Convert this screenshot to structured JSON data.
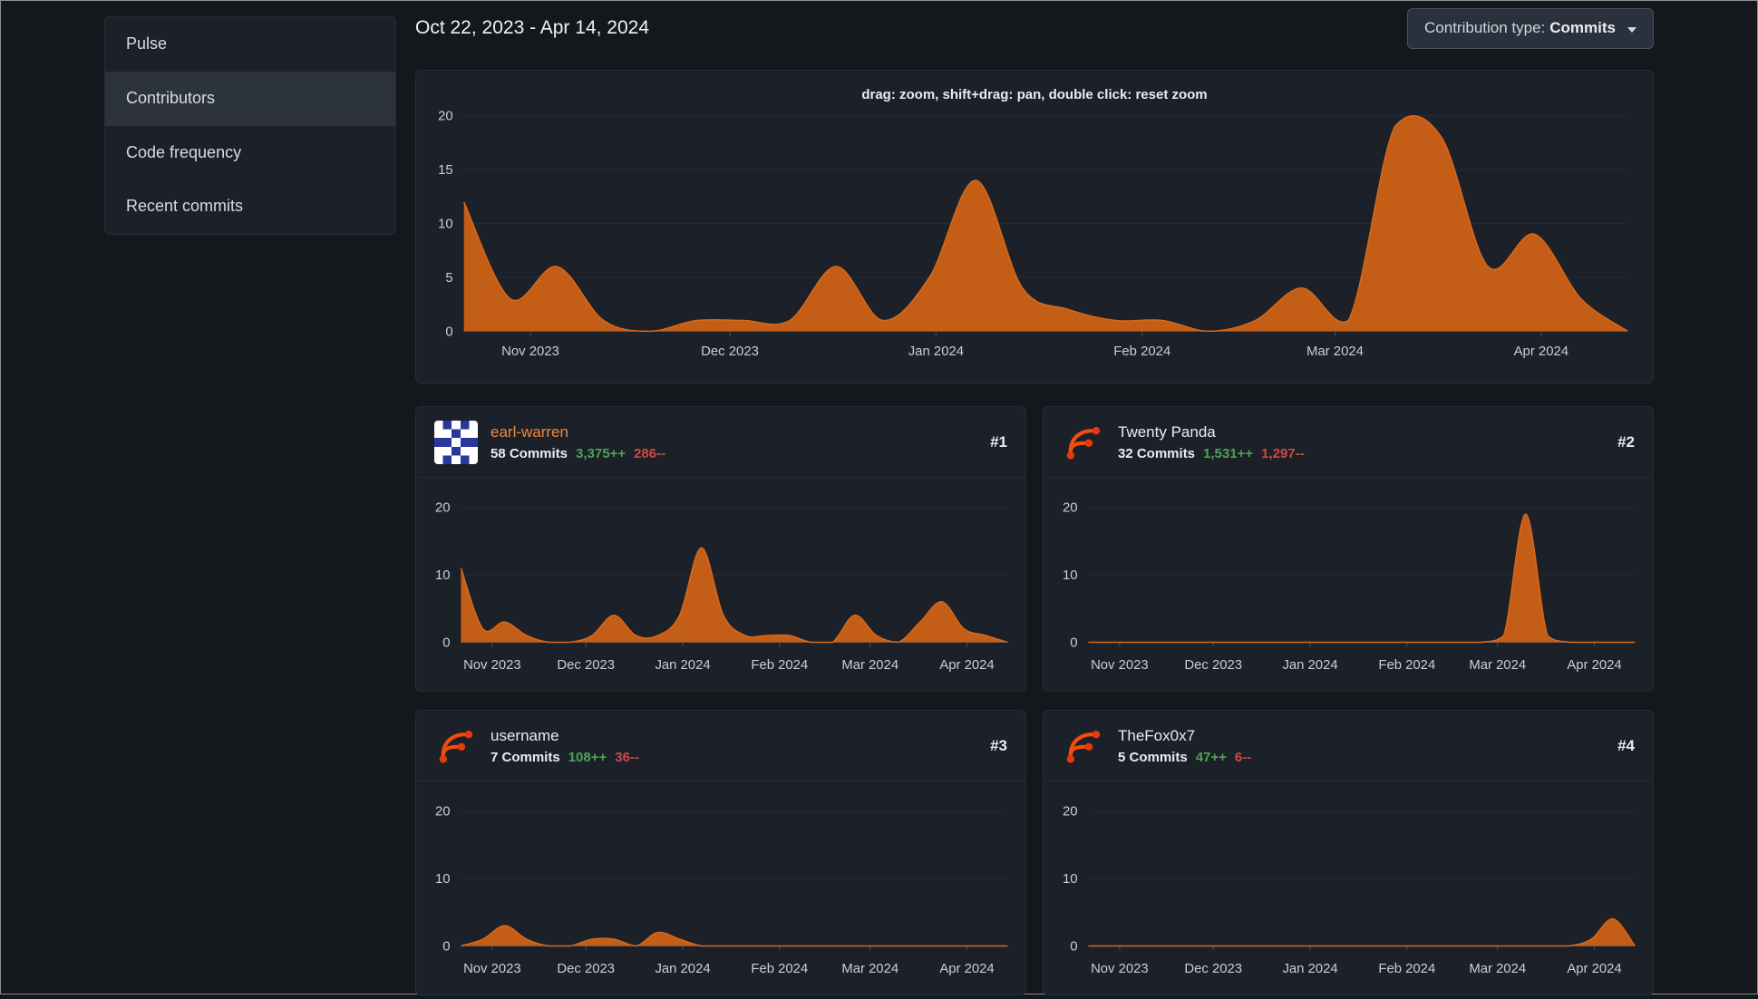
{
  "header": {
    "date_range": "Oct 22, 2023 - Apr 14, 2024",
    "contribution_type_label": "Contribution type:",
    "contribution_type_value": "Commits"
  },
  "sidebar": {
    "items": [
      {
        "label": "Pulse"
      },
      {
        "label": "Contributors"
      },
      {
        "label": "Code frequency"
      },
      {
        "label": "Recent commits"
      }
    ],
    "active": "Contributors"
  },
  "main_chart": {
    "hint": "drag: zoom, shift+drag: pan, double click: reset zoom"
  },
  "contributors": [
    {
      "rank": "#1",
      "name": "earl-warren",
      "commits": "58 Commits",
      "additions": "3,375++",
      "deletions": "286--",
      "avatar": "identicon-blue"
    },
    {
      "rank": "#2",
      "name": "Twenty Panda",
      "commits": "32 Commits",
      "additions": "1,531++",
      "deletions": "1,297--",
      "avatar": "forgejo-logo"
    },
    {
      "rank": "#3",
      "name": "username",
      "commits": "7 Commits",
      "additions": "108++",
      "deletions": "36--",
      "avatar": "forgejo-logo"
    },
    {
      "rank": "#4",
      "name": "TheFox0x7",
      "commits": "5 Commits",
      "additions": "47++",
      "deletions": "6--",
      "avatar": "forgejo-logo"
    }
  ],
  "colors": {
    "background": "#14171c",
    "card_background": "#1c2129",
    "area_fill": "#c45d16",
    "area_edge": "#d8691b",
    "additions_green": "#4da355",
    "deletions_red": "#cf4745",
    "username_link_orange": "#f0883e"
  },
  "chart_data": [
    {
      "id": "overall-commits",
      "type": "area",
      "x_start": "Oct 22, 2023",
      "x_end": "Apr 14, 2024",
      "x_tick_labels": [
        "Nov 2023",
        "Dec 2023",
        "Jan 2024",
        "Feb 2024",
        "Mar 2024",
        "Apr 2024"
      ],
      "y_ticks": [
        0,
        5,
        10,
        15,
        20
      ],
      "ylim": [
        0,
        20
      ],
      "grid": true,
      "series": [
        {
          "name": "Commits",
          "color": "#c45d16",
          "edge_color": "#d8691b",
          "weekly_values": [
            12,
            3,
            6,
            1,
            0,
            1,
            1,
            1,
            6,
            1,
            5,
            14,
            4,
            2,
            1,
            1,
            0,
            1,
            4,
            1,
            19,
            18,
            6,
            9,
            3,
            0
          ]
        }
      ]
    },
    {
      "id": "earl-warren-commits",
      "type": "area",
      "x_start": "Oct 22, 2023",
      "x_end": "Apr 14, 2024",
      "x_tick_labels": [
        "Nov 2023",
        "Dec 2023",
        "Jan 2024",
        "Feb 2024",
        "Mar 2024",
        "Apr 2024"
      ],
      "y_ticks": [
        0,
        10,
        20
      ],
      "ylim": [
        0,
        20
      ],
      "grid": true,
      "series": [
        {
          "name": "Commits",
          "color": "#c45d16",
          "edge_color": "#d8691b",
          "weekly_values": [
            11,
            2,
            3,
            1,
            0,
            0,
            1,
            4,
            1,
            1,
            4,
            14,
            4,
            1,
            1,
            1,
            0,
            0,
            4,
            1,
            0,
            3,
            6,
            2,
            1,
            0
          ]
        }
      ]
    },
    {
      "id": "twenty-panda-commits",
      "type": "area",
      "x_start": "Oct 22, 2023",
      "x_end": "Apr 14, 2024",
      "x_tick_labels": [
        "Nov 2023",
        "Dec 2023",
        "Jan 2024",
        "Feb 2024",
        "Mar 2024",
        "Apr 2024"
      ],
      "y_ticks": [
        0,
        10,
        20
      ],
      "ylim": [
        0,
        20
      ],
      "grid": true,
      "series": [
        {
          "name": "Commits",
          "color": "#c45d16",
          "edge_color": "#d8691b",
          "weekly_values": [
            0,
            0,
            0,
            0,
            0,
            0,
            0,
            0,
            0,
            0,
            0,
            0,
            0,
            0,
            0,
            0,
            0,
            0,
            0,
            1,
            19,
            1,
            0,
            0,
            0,
            0
          ]
        }
      ]
    },
    {
      "id": "username-commits",
      "type": "area",
      "x_start": "Oct 22, 2023",
      "x_end": "Apr 14, 2024",
      "x_tick_labels": [
        "Nov 2023",
        "Dec 2023",
        "Jan 2024",
        "Feb 2024",
        "Mar 2024",
        "Apr 2024"
      ],
      "y_ticks": [
        0,
        10,
        20
      ],
      "ylim": [
        0,
        20
      ],
      "grid": true,
      "series": [
        {
          "name": "Commits",
          "color": "#c45d16",
          "edge_color": "#d8691b",
          "weekly_values": [
            0,
            1,
            3,
            1,
            0,
            0,
            1,
            1,
            0,
            2,
            1,
            0,
            0,
            0,
            0,
            0,
            0,
            0,
            0,
            0,
            0,
            0,
            0,
            0,
            0,
            0
          ]
        }
      ]
    },
    {
      "id": "thefox0x7-commits",
      "type": "area",
      "x_start": "Oct 22, 2023",
      "x_end": "Apr 14, 2024",
      "x_tick_labels": [
        "Nov 2023",
        "Dec 2023",
        "Jan 2024",
        "Feb 2024",
        "Mar 2024",
        "Apr 2024"
      ],
      "y_ticks": [
        0,
        10,
        20
      ],
      "ylim": [
        0,
        20
      ],
      "grid": true,
      "series": [
        {
          "name": "Commits",
          "color": "#c45d16",
          "edge_color": "#d8691b",
          "weekly_values": [
            0,
            0,
            0,
            0,
            0,
            0,
            0,
            0,
            0,
            0,
            0,
            0,
            0,
            0,
            0,
            0,
            0,
            0,
            0,
            0,
            0,
            0,
            0,
            1,
            4,
            0
          ]
        }
      ]
    }
  ]
}
